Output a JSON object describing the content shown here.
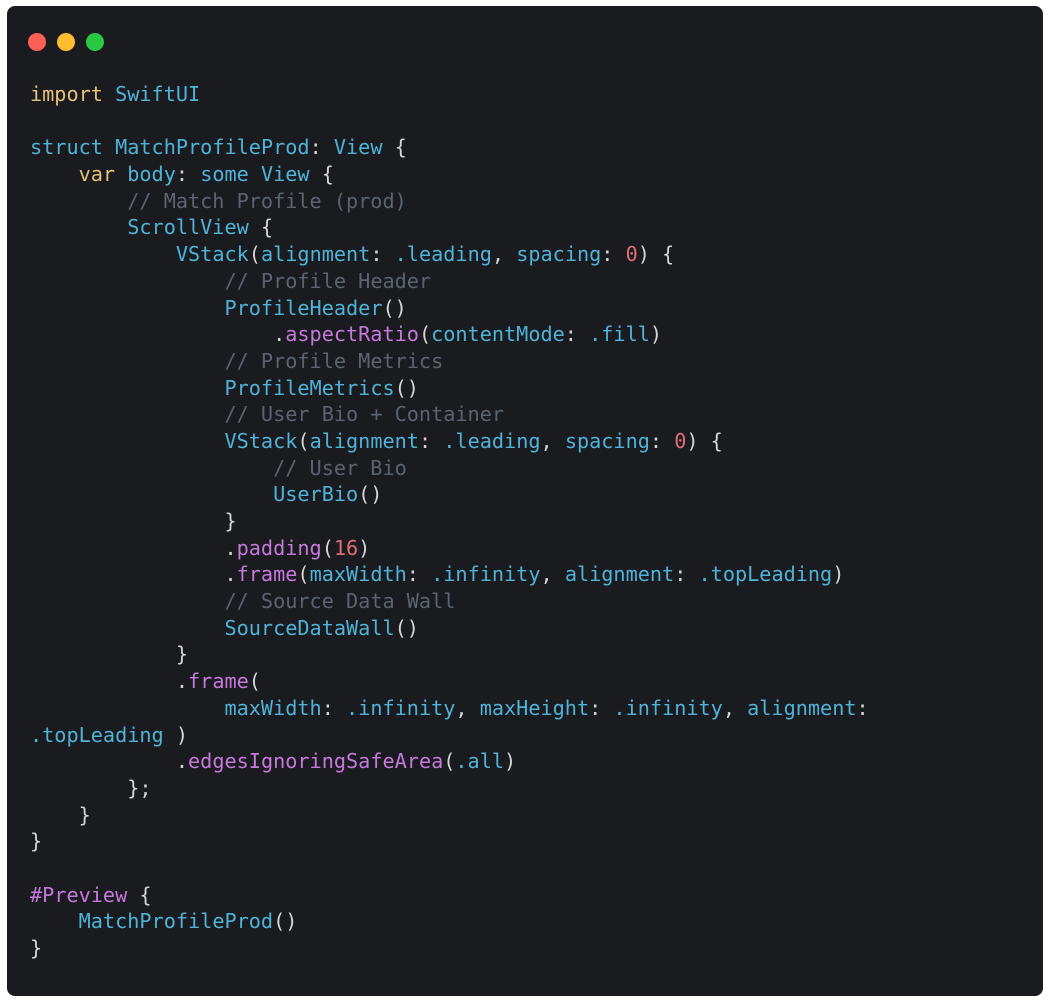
{
  "window": {
    "controls": [
      {
        "name": "close-button",
        "color": "#fe5f57"
      },
      {
        "name": "minimize-button",
        "color": "#febc2e"
      },
      {
        "name": "zoom-button",
        "color": "#28c840"
      }
    ]
  },
  "colors": {
    "background": "#1a1b1e",
    "default": "#d4d4d4",
    "keyword": "#e5c07b",
    "type": "#4fb3d9",
    "comment": "#5c6370",
    "method": "#c678dd",
    "number": "#e06c75"
  },
  "code": {
    "language": "Swift",
    "lines": [
      [
        [
          "import",
          "keyword"
        ],
        [
          " ",
          "default"
        ],
        [
          "SwiftUI",
          "type"
        ]
      ],
      [],
      [
        [
          "struct",
          "type"
        ],
        [
          " ",
          "default"
        ],
        [
          "MatchProfileProd",
          "type"
        ],
        [
          ": ",
          "default"
        ],
        [
          "View",
          "type"
        ],
        [
          " {",
          "default"
        ]
      ],
      [
        [
          "    ",
          "default"
        ],
        [
          "var",
          "keyword"
        ],
        [
          " ",
          "default"
        ],
        [
          "body",
          "type"
        ],
        [
          ": ",
          "default"
        ],
        [
          "some",
          "type"
        ],
        [
          " ",
          "default"
        ],
        [
          "View",
          "type"
        ],
        [
          " {",
          "default"
        ]
      ],
      [
        [
          "        ",
          "default"
        ],
        [
          "// Match Profile (prod)",
          "comment"
        ]
      ],
      [
        [
          "        ",
          "default"
        ],
        [
          "ScrollView",
          "type"
        ],
        [
          " {",
          "default"
        ]
      ],
      [
        [
          "            ",
          "default"
        ],
        [
          "VStack",
          "type"
        ],
        [
          "(",
          "default"
        ],
        [
          "alignment",
          "type"
        ],
        [
          ": ",
          "default"
        ],
        [
          ".leading",
          "type"
        ],
        [
          ", ",
          "default"
        ],
        [
          "spacing",
          "type"
        ],
        [
          ": ",
          "default"
        ],
        [
          "0",
          "number"
        ],
        [
          ") {",
          "default"
        ]
      ],
      [
        [
          "                ",
          "default"
        ],
        [
          "// Profile Header",
          "comment"
        ]
      ],
      [
        [
          "                ",
          "default"
        ],
        [
          "ProfileHeader",
          "type"
        ],
        [
          "()",
          "default"
        ]
      ],
      [
        [
          "                    ",
          "default"
        ],
        [
          ".",
          "default"
        ],
        [
          "aspectRatio",
          "method"
        ],
        [
          "(",
          "default"
        ],
        [
          "contentMode",
          "type"
        ],
        [
          ": ",
          "default"
        ],
        [
          ".fill",
          "type"
        ],
        [
          ")",
          "default"
        ]
      ],
      [
        [
          "                ",
          "default"
        ],
        [
          "// Profile Metrics",
          "comment"
        ]
      ],
      [
        [
          "                ",
          "default"
        ],
        [
          "ProfileMetrics",
          "type"
        ],
        [
          "()",
          "default"
        ]
      ],
      [
        [
          "                ",
          "default"
        ],
        [
          "// User Bio + Container",
          "comment"
        ]
      ],
      [
        [
          "                ",
          "default"
        ],
        [
          "VStack",
          "type"
        ],
        [
          "(",
          "default"
        ],
        [
          "alignment",
          "type"
        ],
        [
          ": ",
          "default"
        ],
        [
          ".leading",
          "type"
        ],
        [
          ", ",
          "default"
        ],
        [
          "spacing",
          "type"
        ],
        [
          ": ",
          "default"
        ],
        [
          "0",
          "number"
        ],
        [
          ") {",
          "default"
        ]
      ],
      [
        [
          "                    ",
          "default"
        ],
        [
          "// User Bio",
          "comment"
        ]
      ],
      [
        [
          "                    ",
          "default"
        ],
        [
          "UserBio",
          "type"
        ],
        [
          "()",
          "default"
        ]
      ],
      [
        [
          "                ",
          "default"
        ],
        [
          "}",
          "default"
        ]
      ],
      [
        [
          "                ",
          "default"
        ],
        [
          ".",
          "default"
        ],
        [
          "padding",
          "method"
        ],
        [
          "(",
          "default"
        ],
        [
          "16",
          "number"
        ],
        [
          ")",
          "default"
        ]
      ],
      [
        [
          "                ",
          "default"
        ],
        [
          ".",
          "default"
        ],
        [
          "frame",
          "method"
        ],
        [
          "(",
          "default"
        ],
        [
          "maxWidth",
          "type"
        ],
        [
          ": ",
          "default"
        ],
        [
          ".infinity",
          "type"
        ],
        [
          ", ",
          "default"
        ],
        [
          "alignment",
          "type"
        ],
        [
          ": ",
          "default"
        ],
        [
          ".topLeading",
          "type"
        ],
        [
          ")",
          "default"
        ]
      ],
      [
        [
          "                ",
          "default"
        ],
        [
          "// Source Data Wall",
          "comment"
        ]
      ],
      [
        [
          "                ",
          "default"
        ],
        [
          "SourceDataWall",
          "type"
        ],
        [
          "()",
          "default"
        ]
      ],
      [
        [
          "            ",
          "default"
        ],
        [
          "}",
          "default"
        ]
      ],
      [
        [
          "            ",
          "default"
        ],
        [
          ".",
          "default"
        ],
        [
          "frame",
          "method"
        ],
        [
          "(",
          "default"
        ]
      ],
      [
        [
          "                ",
          "default"
        ],
        [
          "maxWidth",
          "type"
        ],
        [
          ": ",
          "default"
        ],
        [
          ".infinity",
          "type"
        ],
        [
          ", ",
          "default"
        ],
        [
          "maxHeight",
          "type"
        ],
        [
          ": ",
          "default"
        ],
        [
          ".infinity",
          "type"
        ],
        [
          ", ",
          "default"
        ],
        [
          "alignment",
          "type"
        ],
        [
          ":",
          "default"
        ]
      ],
      [
        [
          ".topLeading",
          "type"
        ],
        [
          " )",
          "default"
        ]
      ],
      [
        [
          "            ",
          "default"
        ],
        [
          ".",
          "default"
        ],
        [
          "edgesIgnoringSafeArea",
          "method"
        ],
        [
          "(",
          "default"
        ],
        [
          ".all",
          "type"
        ],
        [
          ")",
          "default"
        ]
      ],
      [
        [
          "        ",
          "default"
        ],
        [
          "};",
          "default"
        ]
      ],
      [
        [
          "    ",
          "default"
        ],
        [
          "}",
          "default"
        ]
      ],
      [
        [
          "}",
          "default"
        ]
      ],
      [],
      [
        [
          "#Preview",
          "method"
        ],
        [
          " {",
          "default"
        ]
      ],
      [
        [
          "    ",
          "default"
        ],
        [
          "MatchProfileProd",
          "type"
        ],
        [
          "()",
          "default"
        ]
      ],
      [
        [
          "}",
          "default"
        ]
      ]
    ]
  }
}
